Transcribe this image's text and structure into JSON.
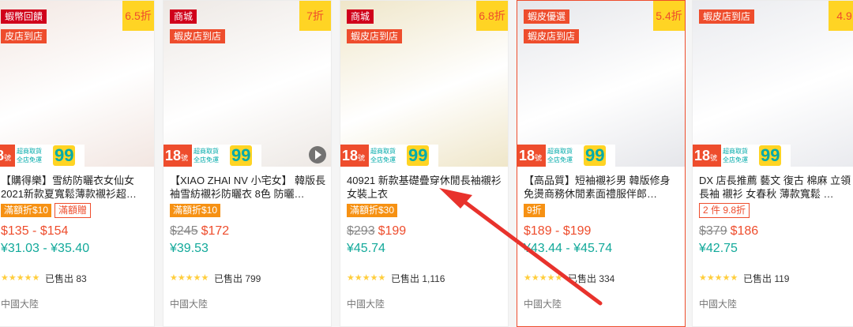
{
  "products": [
    {
      "img_bg": "#f2e6e1",
      "badges": [
        {
          "text": "蝦幣回饋",
          "type": "mall"
        },
        {
          "text": "皮店到店",
          "type": "pref"
        }
      ],
      "discount": "6.5折",
      "title": "【購得樂】雪紡防曬衣女仙女 2021新款夏寬鬆薄款襯衫超…",
      "tags": [
        {
          "text": "滿額折$10",
          "style": "solid"
        },
        {
          "text": "滿額贈",
          "style": "outline"
        }
      ],
      "old_price": "",
      "price": "$135 - $154",
      "price2": "¥31.03 - ¥35.40",
      "sold": "已售出 83",
      "location": "中國大陸",
      "video": false
    },
    {
      "img_bg": "#ede8e4",
      "badges": [
        {
          "text": "商城",
          "type": "mall"
        },
        {
          "text": "蝦皮店到店",
          "type": "pref"
        }
      ],
      "discount": "7折",
      "title": "【XIAO ZHAI NV 小宅女】 韓版長袖雪紡襯衫防曬衣 8色 防曬…",
      "tags": [
        {
          "text": "滿額折$10",
          "style": "solid"
        }
      ],
      "old_price": "$245",
      "price": "$172",
      "price2": "¥39.53",
      "sold": "已售出 799",
      "location": "中國大陸",
      "video": true
    },
    {
      "img_bg": "#efe6c9",
      "badges": [
        {
          "text": "商城",
          "type": "mall"
        },
        {
          "text": "蝦皮店到店",
          "type": "pref"
        }
      ],
      "discount": "6.8折",
      "title": "40921 新款基礎疊穿休閒長袖襯衫女裝上衣",
      "tags": [
        {
          "text": "滿額折$30",
          "style": "solid"
        }
      ],
      "old_price": "$293",
      "price": "$199",
      "price2": "¥45.74",
      "sold": "已售出 1,116",
      "location": "中國大陸",
      "video": false
    },
    {
      "img_bg": "#e5e6ea",
      "badges": [
        {
          "text": "蝦皮優選",
          "type": "pref"
        },
        {
          "text": "蝦皮店到店",
          "type": "pref"
        }
      ],
      "discount": "5.4折",
      "title": "【高品質】短袖襯衫男 韓版修身免燙商務休閒素面禮服伴郎…",
      "tags": [
        {
          "text": "9折",
          "style": "solid"
        }
      ],
      "old_price": "",
      "price": "$189 - $199",
      "price2": "¥43.44 - ¥45.74",
      "sold": "已售出 334",
      "location": "中國大陸",
      "video": false
    },
    {
      "img_bg": "#e9eaee",
      "badges": [
        {
          "text": "蝦皮店到店",
          "type": "pref"
        }
      ],
      "discount": "4.9",
      "title": "DX 店長推薦 藝文 復古 棉麻 立領長袖 襯衫 女春秋 薄款寬鬆 …",
      "tags": [
        {
          "text": "2 件 9.8折",
          "style": "outline"
        }
      ],
      "old_price": "$379",
      "price": "$186",
      "price2": "¥42.75",
      "sold": "已售出 119",
      "location": "中國大陸",
      "video": false
    }
  ],
  "common": {
    "strip_num": "18",
    "strip_unit": "號",
    "strip_text1": "超商取貨",
    "strip_text2": "全店免運",
    "strip_99": "99",
    "stars": "★★★★★"
  },
  "colors": {
    "accent": "#ee4d2d",
    "teal": "#12a99a"
  }
}
